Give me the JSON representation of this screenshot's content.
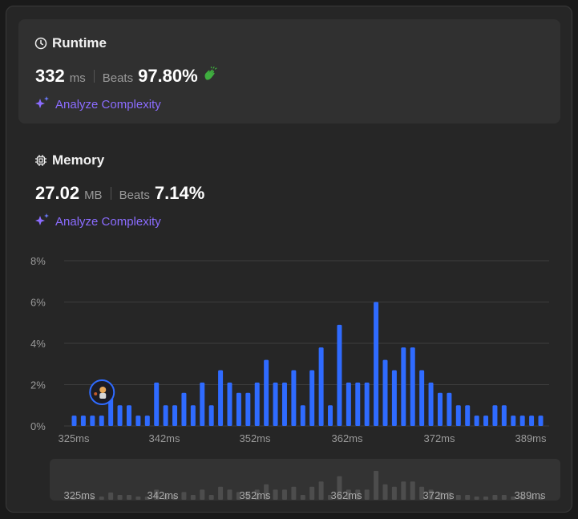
{
  "runtime": {
    "title": "Runtime",
    "value": "332",
    "unit": "ms",
    "beats_label": "Beats",
    "beats_value": "97.80%",
    "analyze_label": "Analyze Complexity"
  },
  "memory": {
    "title": "Memory",
    "value": "27.02",
    "unit": "MB",
    "beats_label": "Beats",
    "beats_value": "7.14%",
    "analyze_label": "Analyze Complexity"
  },
  "colors": {
    "bar": "#2f6bff",
    "accent_purple": "#8b6cff",
    "grid": "#3d3d3d",
    "minimap_bar": "#4d4d4d",
    "clap_green": "#3fae3f"
  },
  "chart_data": {
    "type": "bar",
    "ylim": [
      0,
      8
    ],
    "y_ticks": [
      "0%",
      "2%",
      "4%",
      "6%",
      "8%"
    ],
    "x_tick_labels": [
      "325ms",
      "342ms",
      "352ms",
      "362ms",
      "372ms",
      "389ms"
    ],
    "values": [
      0.5,
      0.5,
      0.5,
      0.5,
      1.5,
      1.0,
      1.0,
      0.5,
      0.5,
      2.1,
      1.0,
      1.0,
      1.6,
      1.0,
      2.1,
      1.0,
      2.7,
      2.1,
      1.6,
      1.6,
      2.1,
      3.2,
      2.1,
      2.1,
      2.7,
      1.0,
      2.7,
      3.8,
      1.0,
      4.9,
      2.1,
      2.1,
      2.1,
      6.0,
      3.2,
      2.7,
      3.8,
      3.8,
      2.7,
      2.1,
      1.6,
      1.6,
      1.0,
      1.0,
      0.5,
      0.5,
      1.0,
      1.0,
      0.5,
      0.5,
      0.5,
      0.5
    ],
    "highlight_index": 3
  },
  "minimap": {
    "x_tick_labels": [
      "325ms",
      "342ms",
      "352ms",
      "362ms",
      "372ms",
      "389ms"
    ]
  }
}
